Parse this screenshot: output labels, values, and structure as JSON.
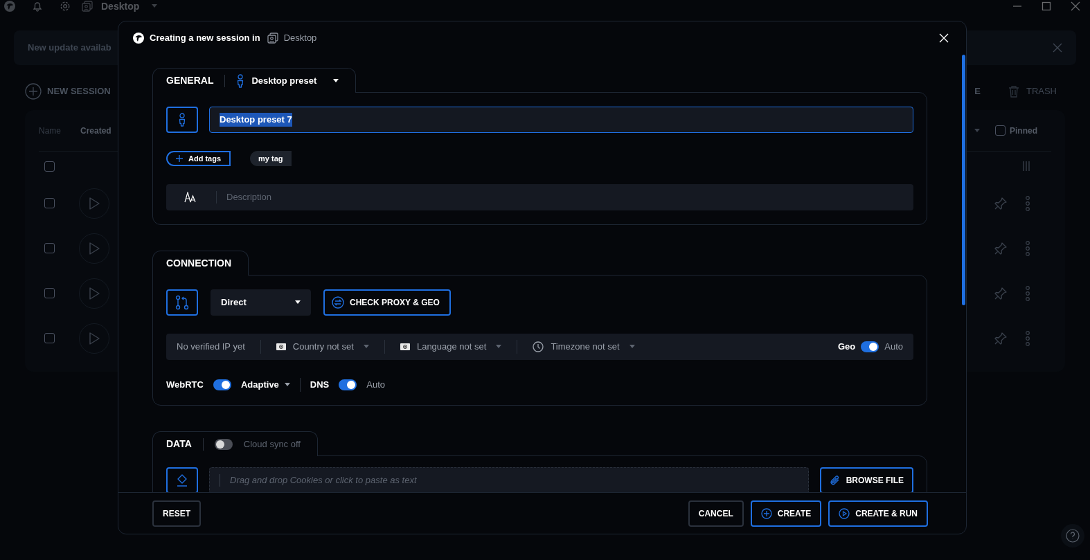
{
  "app": {
    "title": "Desktop",
    "update_banner": "New update availab",
    "new_session": "NEW SESSION",
    "toolbar_partial": "E",
    "trash": "TRASH",
    "columns": [
      "Name",
      "Created"
    ],
    "pinned_filter": {
      "label": "Pinned",
      "checked": false
    },
    "rows": [
      {
        "kind": "header",
        "checked": false
      },
      {
        "kind": "session",
        "checked": false
      },
      {
        "kind": "session",
        "checked": false
      },
      {
        "kind": "session",
        "checked": false
      },
      {
        "kind": "session",
        "checked": false
      }
    ]
  },
  "modal": {
    "title": "Creating a new session in",
    "folder": "Desktop",
    "general": {
      "title": "GENERAL",
      "preset": "Desktop preset",
      "name_value": "Desktop preset 7",
      "add_tags": "Add tags",
      "tags": [
        "my tag"
      ],
      "description_placeholder": "Description"
    },
    "connection": {
      "title": "CONNECTION",
      "proxy_type": "Direct",
      "check_button": "CHECK PROXY & GEO",
      "ip_status": "No verified IP yet",
      "country": "Country not set",
      "language": "Language not set",
      "timezone": "Timezone not set",
      "geo": {
        "label": "Geo",
        "on": true,
        "mode": "Auto"
      },
      "webrtc": {
        "label": "WebRTC",
        "on": true,
        "mode": "Adaptive"
      },
      "dns": {
        "label": "DNS",
        "on": true,
        "mode": "Auto"
      }
    },
    "data": {
      "title": "DATA",
      "cloud_sync": {
        "on": false,
        "label": "Cloud sync off"
      },
      "cookies_placeholder": "Drag and drop Cookies or click to paste as text",
      "browse": "BROWSE FILE"
    },
    "footer": {
      "reset": "RESET",
      "cancel": "CANCEL",
      "create": "CREATE",
      "create_run": "CREATE & RUN"
    }
  }
}
